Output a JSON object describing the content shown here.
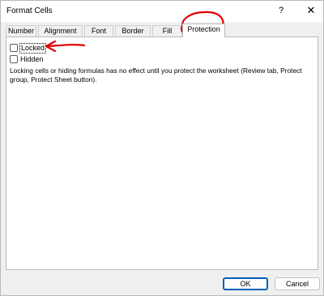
{
  "window": {
    "title": "Format Cells",
    "help_label": "?",
    "close_label": "✕"
  },
  "tabs": [
    {
      "label": "Number"
    },
    {
      "label": "Alignment"
    },
    {
      "label": "Font"
    },
    {
      "label": "Border"
    },
    {
      "label": "Fill"
    },
    {
      "label": "Protection",
      "active": true
    }
  ],
  "protection": {
    "locked_label": "Locked",
    "locked_checked": false,
    "hidden_label": "Hidden",
    "hidden_checked": false,
    "note": "Locking cells or hiding formulas has no effect until you protect the worksheet (Review tab, Protect group, Protect Sheet button)."
  },
  "footer": {
    "ok_label": "OK",
    "cancel_label": "Cancel"
  },
  "annotation_color": "#e00000"
}
